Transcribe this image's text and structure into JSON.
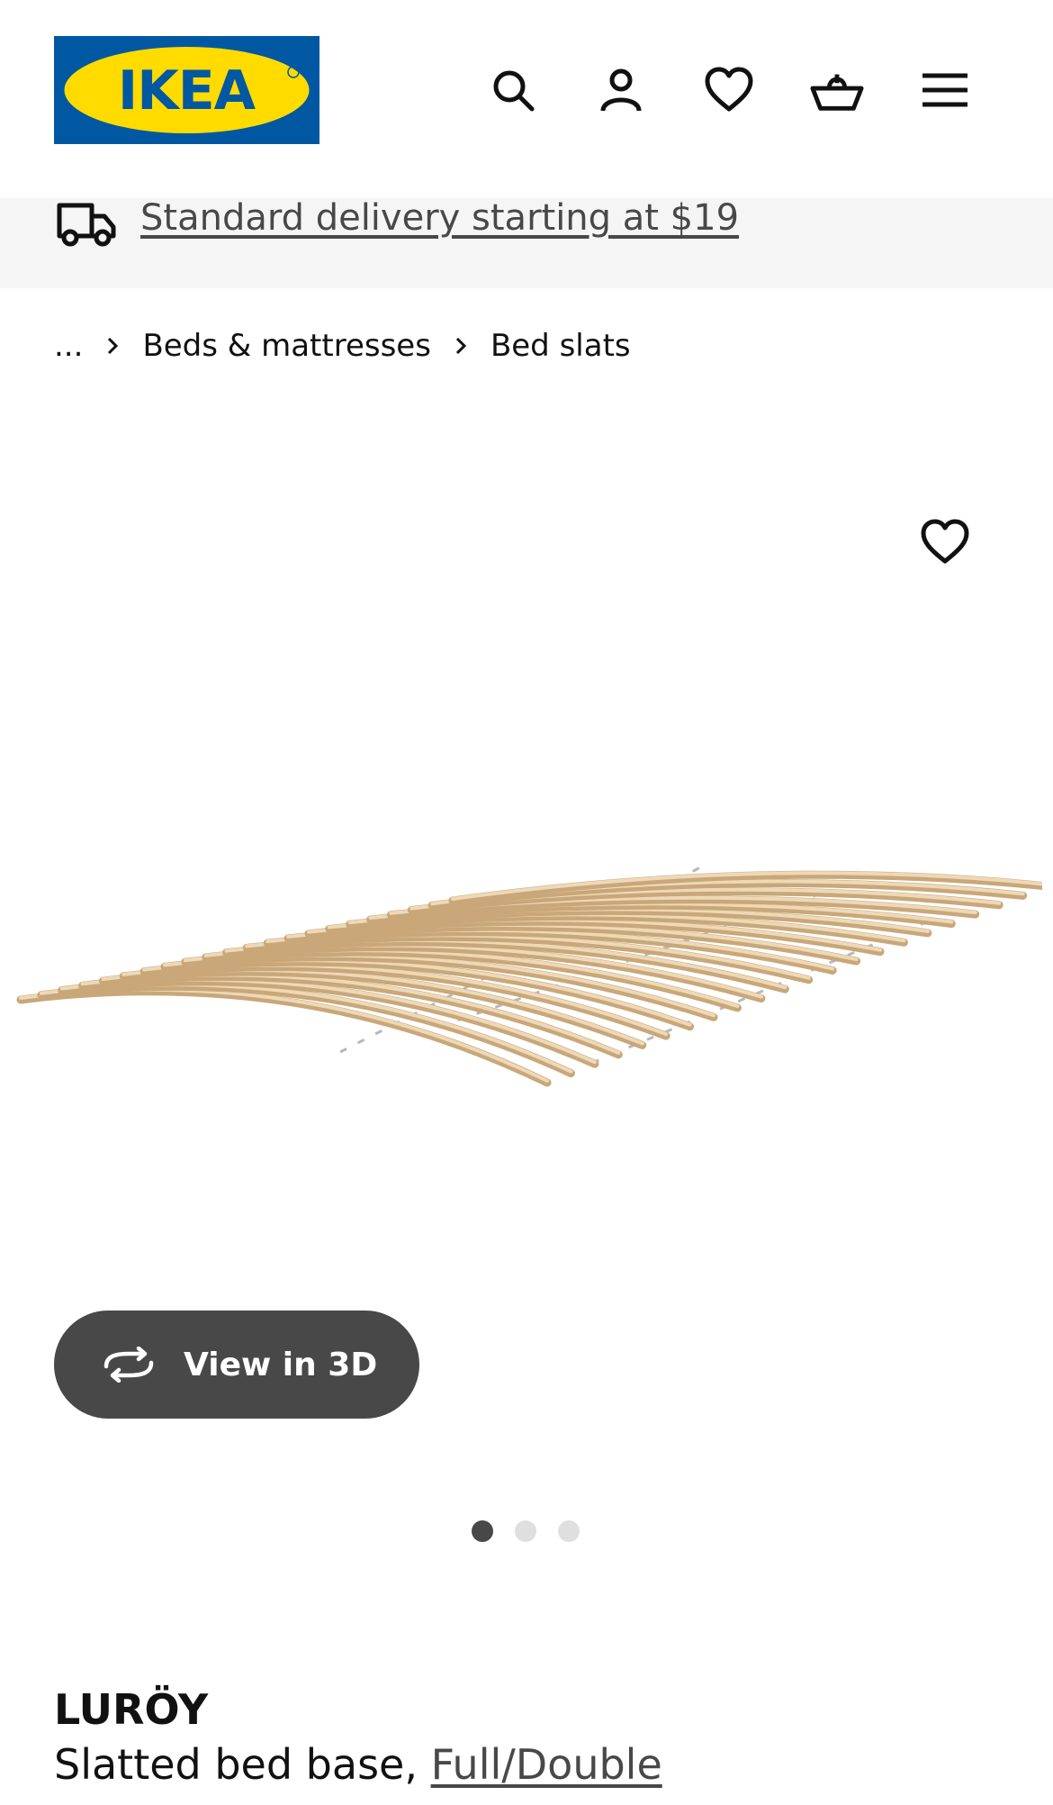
{
  "header": {
    "logo_text": "IKEA",
    "icons": [
      "search-icon",
      "account-icon",
      "heart-icon",
      "basket-icon",
      "menu-icon"
    ]
  },
  "delivery": {
    "icon": "truck-icon",
    "text": "Standard delivery starting at $19"
  },
  "breadcrumb": {
    "ellipsis": "...",
    "items": [
      "Beds & mattresses",
      "Bed slats"
    ]
  },
  "gallery": {
    "view3d_label": "View in 3D",
    "slide_count": 3,
    "active_slide": 1
  },
  "product": {
    "name": "LURÖY",
    "description": "Slatted bed base,",
    "size": "Full/Double"
  },
  "colors": {
    "brand_blue": "#0058a3",
    "brand_yellow": "#ffdb00",
    "dark_gray": "#484848"
  }
}
